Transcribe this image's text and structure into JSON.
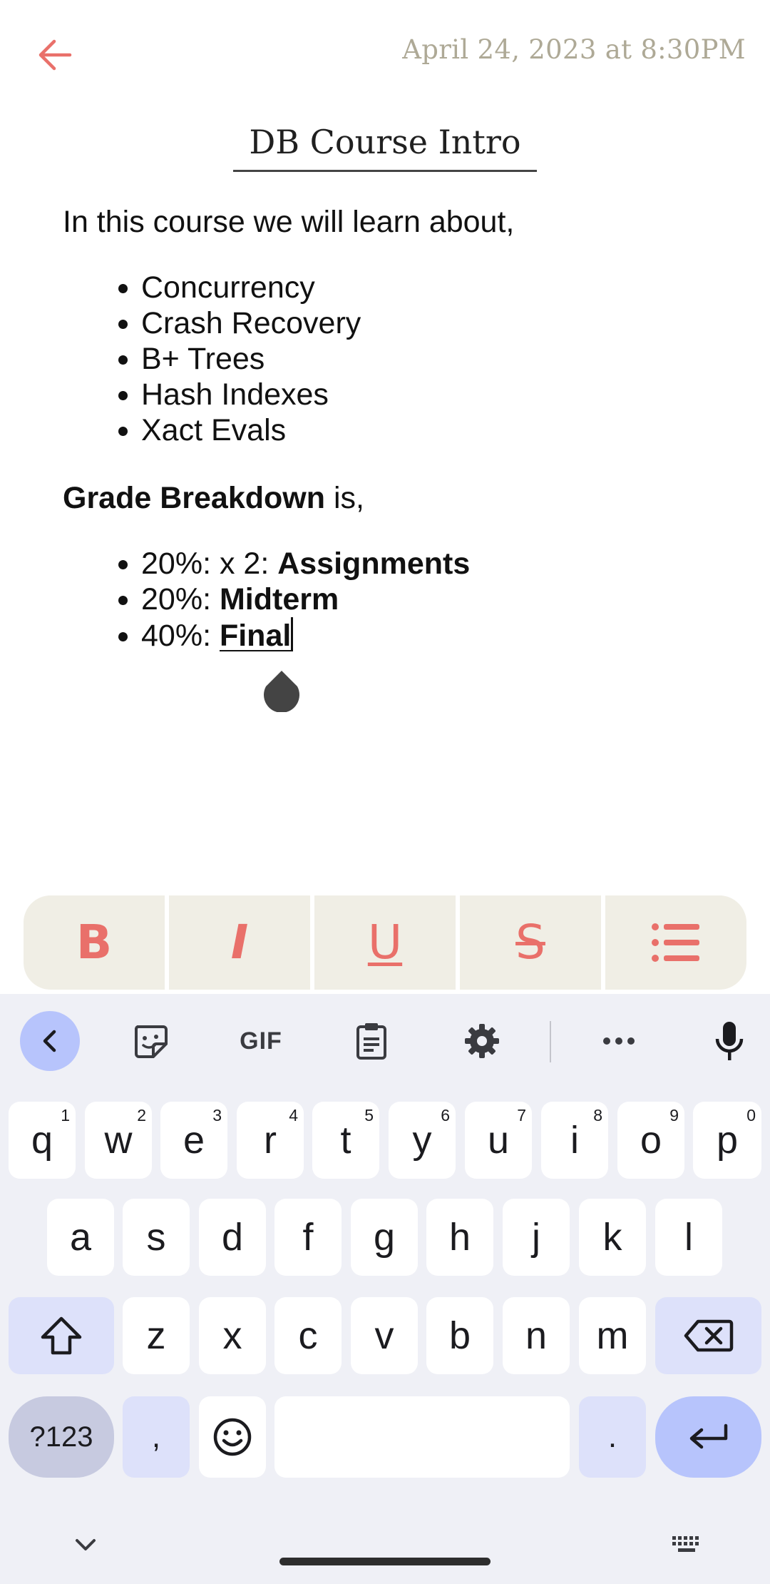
{
  "header": {
    "timestamp": "April 24, 2023 at 8:30PM"
  },
  "note": {
    "title": "DB Course Intro",
    "intro": "In this course we will learn about,",
    "topics": [
      "Concurrency",
      "Crash Recovery",
      "B+ Trees",
      "Hash Indexes",
      "Xact Evals"
    ],
    "grade_heading_bold": "Grade Breakdown",
    "grade_heading_rest": " is,",
    "grades": [
      {
        "prefix": "20%: x 2: ",
        "bold": "Assignments"
      },
      {
        "prefix": "20%: ",
        "bold": "Midterm"
      },
      {
        "prefix": "40%: ",
        "bold": "Final"
      }
    ]
  },
  "format_toolbar": {
    "bold": "B",
    "italic": "I",
    "underline": "U",
    "strikethrough": "S",
    "accent_color": "#e9706a",
    "background_color": "#f0eee5"
  },
  "keyboard": {
    "toolbar": {
      "gif_label": "GIF",
      "icons": [
        "chevron-left-icon",
        "sticker-icon",
        "gif-icon",
        "clipboard-icon",
        "settings-icon",
        "more-icon",
        "microphone-icon"
      ]
    },
    "row1": [
      {
        "k": "q",
        "h": "1"
      },
      {
        "k": "w",
        "h": "2"
      },
      {
        "k": "e",
        "h": "3"
      },
      {
        "k": "r",
        "h": "4"
      },
      {
        "k": "t",
        "h": "5"
      },
      {
        "k": "y",
        "h": "6"
      },
      {
        "k": "u",
        "h": "7"
      },
      {
        "k": "i",
        "h": "8"
      },
      {
        "k": "o",
        "h": "9"
      },
      {
        "k": "p",
        "h": "0"
      }
    ],
    "row2": [
      "a",
      "s",
      "d",
      "f",
      "g",
      "h",
      "j",
      "k",
      "l"
    ],
    "row3": [
      "z",
      "x",
      "c",
      "v",
      "b",
      "n",
      "m"
    ],
    "symbols_label": "?123",
    "comma": ",",
    "period": ".",
    "accent_color": "#b7c4fc"
  }
}
